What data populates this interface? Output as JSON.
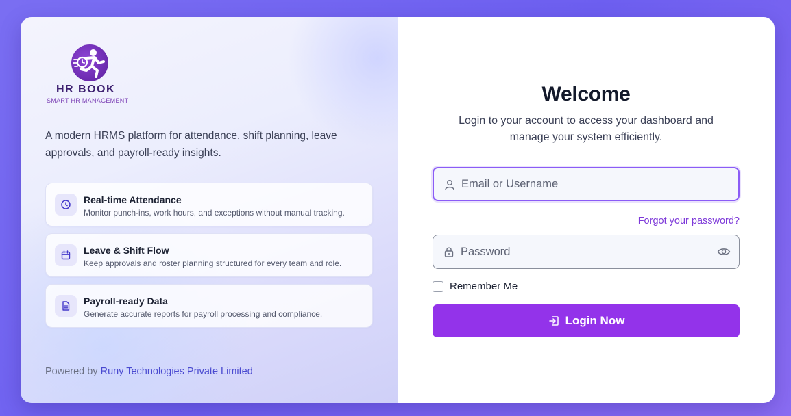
{
  "brand": {
    "name": "HR BOOK",
    "tagline": "SMART HR MANAGEMENT",
    "logo_icon": "runner-with-clock-logo"
  },
  "intro": "A modern HRMS platform for attendance, shift planning, leave approvals, and payroll-ready insights.",
  "features": [
    {
      "icon": "clock-icon",
      "title": "Real-time Attendance",
      "description": "Monitor punch-ins, work hours, and exceptions without manual tracking."
    },
    {
      "icon": "calendar-icon",
      "title": "Leave & Shift Flow",
      "description": "Keep approvals and roster planning structured for every team and role."
    },
    {
      "icon": "document-icon",
      "title": "Payroll-ready Data",
      "description": "Generate accurate reports for payroll processing and compliance."
    }
  ],
  "footer": {
    "powered_prefix": "Powered by",
    "company": "Runy Technologies Private Limited"
  },
  "login": {
    "title": "Welcome",
    "subtitle": "Login to your account to access your dashboard and manage your system efficiently.",
    "username": {
      "value": "",
      "placeholder": "Email or Username",
      "icon": "user-icon"
    },
    "forgot_label": "Forgot your password?",
    "password": {
      "value": "",
      "placeholder": "Password",
      "icon": "lock-icon",
      "toggle_icon": "eye-icon"
    },
    "remember_label": "Remember Me",
    "remember_checked": false,
    "submit_label": "Login Now",
    "submit_icon": "login-icon"
  },
  "colors": {
    "accent": "#9333ea",
    "link": "#7e3ad9",
    "background": "#7a6ef2",
    "focus_border": "#8b5cf6"
  }
}
